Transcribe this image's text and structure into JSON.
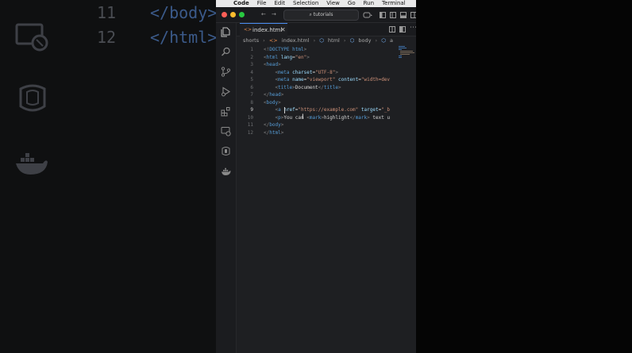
{
  "menubar": {
    "app": "Code",
    "items": [
      "File",
      "Edit",
      "Selection",
      "View",
      "Go",
      "Run",
      "Terminal"
    ]
  },
  "titlebar": {
    "search_label": "tutorials"
  },
  "tab": {
    "label": "index.html",
    "close": "✕"
  },
  "breadcrumbs": [
    "shorts",
    "index.html",
    "html",
    "body",
    "a"
  ],
  "background_code": [
    {
      "num": "11",
      "code": "</body>"
    },
    {
      "num": "12",
      "code": "</html>"
    }
  ],
  "editor": {
    "active_line": 9,
    "lines": [
      {
        "num": "1",
        "code": "<!DOCTYPE html>"
      },
      {
        "num": "2",
        "code": "<html lang=\"en\">"
      },
      {
        "num": "3",
        "code": "<head>"
      },
      {
        "num": "4",
        "code": "    <meta charset=\"UTF-8\">"
      },
      {
        "num": "5",
        "code": "    <meta name=\"viewport\" content=\"width=dev"
      },
      {
        "num": "6",
        "code": "    <title>Document</title>"
      },
      {
        "num": "7",
        "code": "</head>"
      },
      {
        "num": "8",
        "code": "<body>"
      },
      {
        "num": "9",
        "code": "    <a href=\"https://example.com\" target=\"_b"
      },
      {
        "num": "10",
        "code": "    <p>You can <mark>highlight</mark> text u"
      },
      {
        "num": "11",
        "code": "</body>"
      },
      {
        "num": "12",
        "code": "</html>"
      }
    ]
  },
  "colors": {
    "tag": "#569cd6",
    "attribute": "#9cdcfe",
    "string": "#ce9178",
    "accent": "#4a8cf0",
    "close_dot": "#ff5f57",
    "minimize_dot": "#febc2e",
    "zoom_dot": "#28c840"
  }
}
